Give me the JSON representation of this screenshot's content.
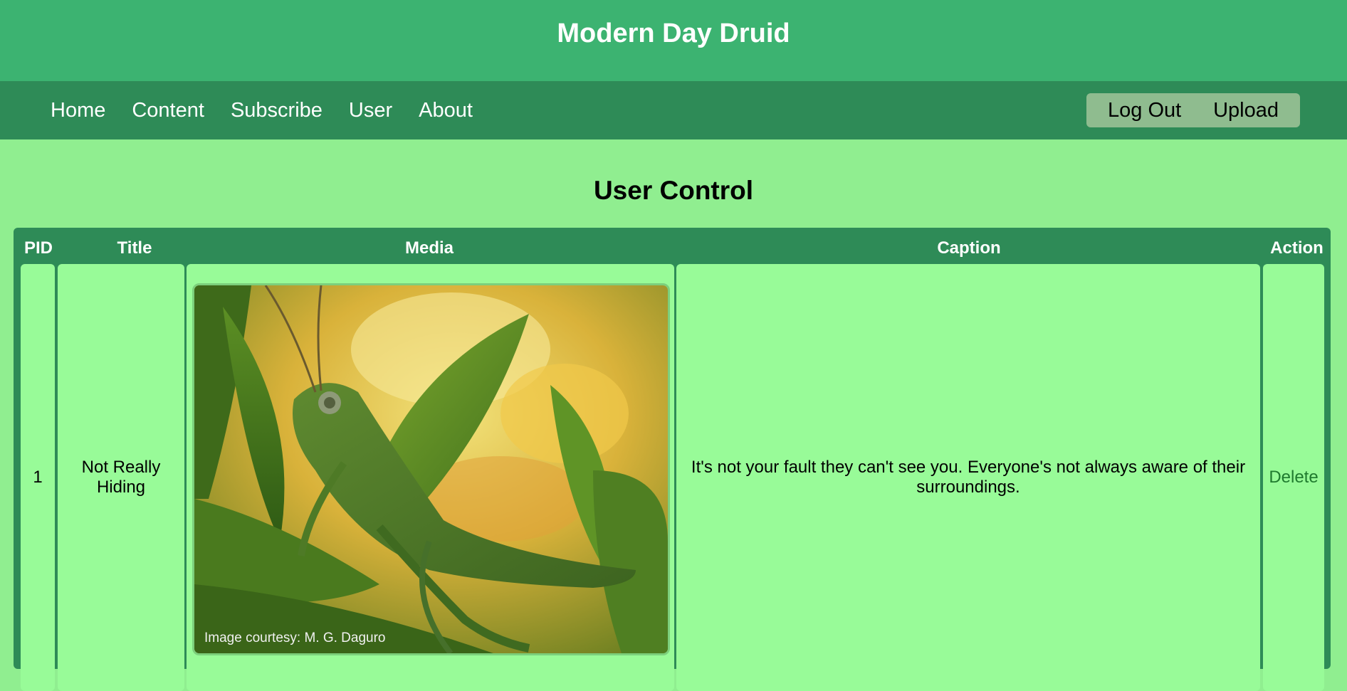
{
  "header": {
    "title": "Modern Day Druid"
  },
  "nav": {
    "links": [
      "Home",
      "Content",
      "Subscribe",
      "User",
      "About"
    ],
    "logout_label": "Log Out",
    "upload_label": "Upload"
  },
  "page": {
    "title": "User Control"
  },
  "table": {
    "columns": [
      "PID",
      "Title",
      "Media",
      "Caption",
      "Action"
    ],
    "rows": [
      {
        "pid": "1",
        "title": "Not Really Hiding",
        "media_credit": "Image courtesy: M. G. Daguro",
        "caption": "It's not your fault they can't see you. Everyone's not always aware of their surroundings.",
        "action": "Delete"
      }
    ]
  },
  "colors": {
    "header_bg": "#3cb371",
    "nav_bg": "#2e8b57",
    "page_bg": "#90ee90",
    "cell_bg": "#98fb98"
  }
}
